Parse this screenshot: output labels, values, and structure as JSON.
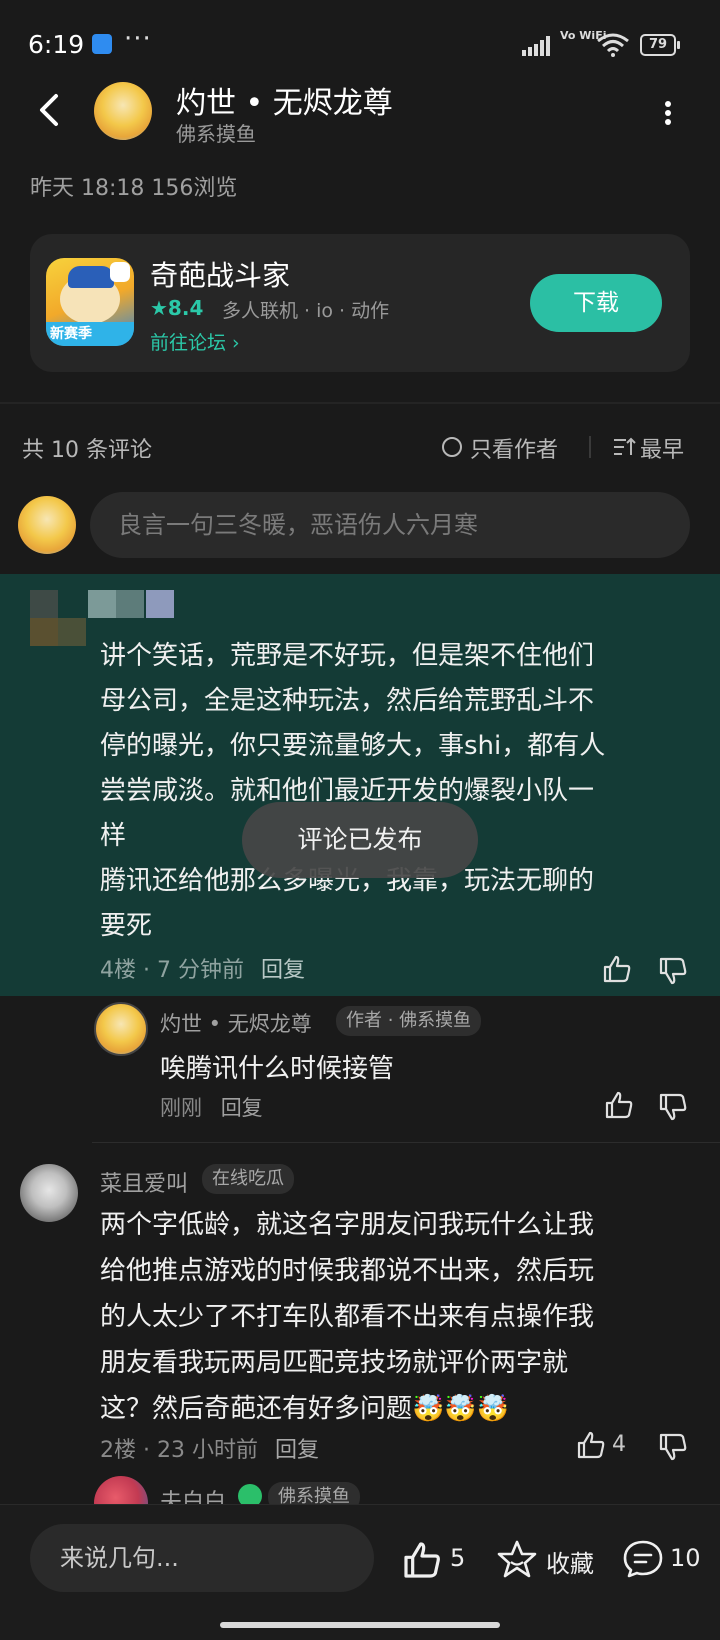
{
  "status_bar": {
    "time": "6:19",
    "dots": "···",
    "network": "Vo WiFi",
    "battery": "79"
  },
  "header": {
    "author_name": "灼世 • 无烬龙尊",
    "author_subtitle": "佛系摸鱼"
  },
  "post_meta": "昨天 18:18   156浏览",
  "game_card": {
    "name": "奇葩战斗家",
    "rating": "★8.4",
    "tags": "多人联机 · io · 动作",
    "forum_link": "前往论坛 ›",
    "download_label": "下载",
    "icon_badge": "新赛季"
  },
  "comments_bar": {
    "count_label": "共 10 条评论",
    "only_author_label": "只看作者",
    "sort_label": "最早"
  },
  "comment_input_placeholder": "良言一句三冬暖，恶语伤人六月寒",
  "highlighted_comment": {
    "lines": [
      "讲个笑话，荒野是不好玩，但是架不住他们",
      "母公司，全是这种玩法，然后给荒野乱斗不",
      "停的曝光，你只要流量够大，事shi，都有人",
      "尝尝咸淡。就和他们最近开发的爆裂小队一",
      "样",
      "腾讯还给他那么多曝光，我靠，玩法无聊的",
      "要死"
    ],
    "floor": "4楼",
    "time": "7 分钟前",
    "reply_label": "回复"
  },
  "reply": {
    "name": "灼世 • 无烬龙尊",
    "badge": "作者 · 佛系摸鱼",
    "text": "唉腾讯什么时候接管",
    "time": "刚刚",
    "reply_label": "回复"
  },
  "comment2": {
    "name": "菜且爱叫",
    "badge": "在线吃瓜",
    "lines": [
      "两个字低龄，就这名字朋友问我玩什么让我",
      "给他推点游戏的时候我都说不出来，然后玩",
      "的人太少了不打车队都看不出来有点操作我",
      "朋友看我玩两局匹配竞技场就评价两字就",
      "这？然后奇葩还有好多问题🤯🤯🤯"
    ],
    "floor": "2楼",
    "time": "23 小时前",
    "reply_label": "回复",
    "likes": "4"
  },
  "comment3": {
    "name": "夫白白",
    "badge": "佛系摸鱼"
  },
  "toast": "评论已发布",
  "bottom_bar": {
    "input_placeholder": "来说几句...",
    "like_count": "5",
    "favorite_label": "收藏",
    "comment_count": "10"
  },
  "colors": {
    "accent": "#2bbfa4",
    "highlight_bg": "#143b36",
    "background": "#1a1a1a"
  }
}
